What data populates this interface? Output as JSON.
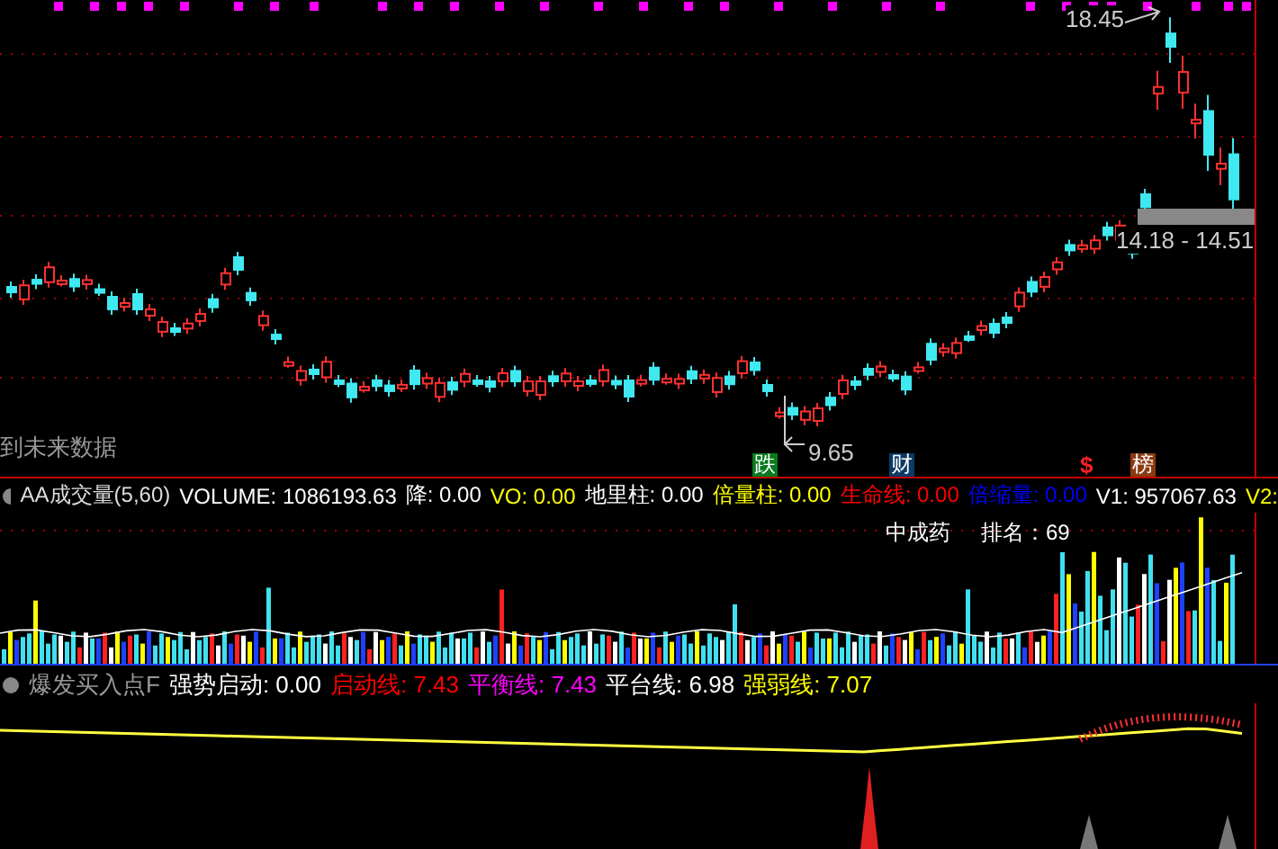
{
  "main_panel": {
    "high_label": "18.45",
    "low_label": "9.65",
    "range_label": "14.18 - 14.51",
    "future_data_label": "到未来数据",
    "markers": [
      {
        "text": "跌",
        "kind": "badge",
        "color": "#0a7a1e"
      },
      {
        "text": "财",
        "kind": "badge",
        "color": "#0b3a66"
      },
      {
        "text": "$",
        "kind": "symbol",
        "color": "#ff2020"
      },
      {
        "text": "榜",
        "kind": "badge",
        "color": "#8a3a10"
      }
    ]
  },
  "volume_legend": {
    "title": "AA成交量(5,60)",
    "items": [
      {
        "text": "VOLUME: 1086193.63",
        "color": "#ffffff"
      },
      {
        "text": "降: 0.00",
        "color": "#ffffff"
      },
      {
        "text": "VO: 0.00",
        "color": "#ffff00"
      },
      {
        "text": "地里柱: 0.00",
        "color": "#ffffff"
      },
      {
        "text": "倍量柱: 0.00",
        "color": "#ffff00"
      },
      {
        "text": "生命线: 0.00",
        "color": "#ff0000"
      },
      {
        "text": "倍缩量: 0.00",
        "color": "#0000ff"
      },
      {
        "text": "V1: 957067.63",
        "color": "#ffffff"
      },
      {
        "text": "V2:",
        "color": "#ffff00"
      }
    ]
  },
  "ranking": {
    "sector": "中成药",
    "rank": "排名：69"
  },
  "indicator_legend": {
    "title": "爆发买入点F",
    "items": [
      {
        "text": "强势启动: 0.00",
        "color": "#ffffff"
      },
      {
        "text": "启动线: 7.43",
        "color": "#ff0000"
      },
      {
        "text": "平衡线: 7.43",
        "color": "#ff00ff"
      },
      {
        "text": "平台线: 6.98",
        "color": "#ffffff"
      },
      {
        "text": "强弱线: 7.07",
        "color": "#ffff00"
      }
    ]
  }
}
